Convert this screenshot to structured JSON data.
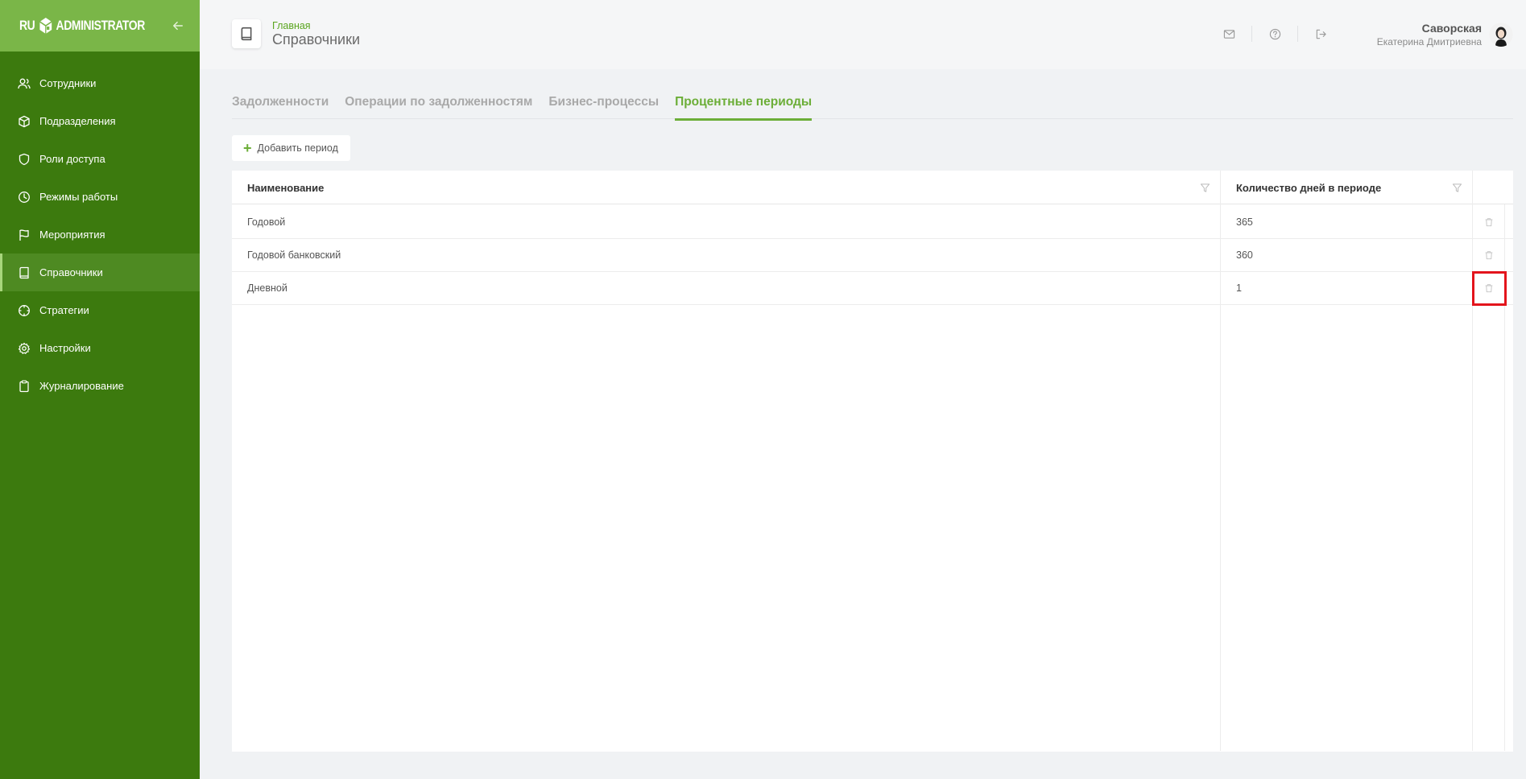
{
  "app": {
    "logo_left": "RU",
    "logo_right": "ADMINISTRATOR"
  },
  "sidebar": {
    "items": [
      {
        "label": "Сотрудники",
        "icon": "users-icon"
      },
      {
        "label": "Подразделения",
        "icon": "cube-icon"
      },
      {
        "label": "Роли доступа",
        "icon": "shield-icon"
      },
      {
        "label": "Режимы работы",
        "icon": "clock-icon"
      },
      {
        "label": "Мероприятия",
        "icon": "flag-icon"
      },
      {
        "label": "Справочники",
        "icon": "book-icon",
        "active": true
      },
      {
        "label": "Стратегии",
        "icon": "crosshair-icon"
      },
      {
        "label": "Настройки",
        "icon": "gear-icon"
      },
      {
        "label": "Журналирование",
        "icon": "clipboard-icon"
      }
    ]
  },
  "header": {
    "breadcrumb": "Главная",
    "title": "Справочники",
    "user_last_name": "Саворская",
    "user_first_name": "Екатерина Дмитриевна"
  },
  "tabs": [
    {
      "label": "Задолженности"
    },
    {
      "label": "Операции по задолженностям"
    },
    {
      "label": "Бизнес-процессы"
    },
    {
      "label": "Процентные периоды",
      "active": true
    }
  ],
  "toolbar": {
    "add_label": "Добавить период"
  },
  "table": {
    "columns": [
      "Наименование",
      "Количество дней в периоде"
    ],
    "rows": [
      {
        "name": "Годовой",
        "days": "365"
      },
      {
        "name": "Годовой банковский",
        "days": "360"
      },
      {
        "name": "Дневной",
        "days": "1"
      }
    ]
  },
  "colors": {
    "sidebar_bg": "#3c7a0e",
    "sidebar_head": "#7ab648",
    "accent": "#6cae38",
    "highlight": "#e3141c"
  }
}
